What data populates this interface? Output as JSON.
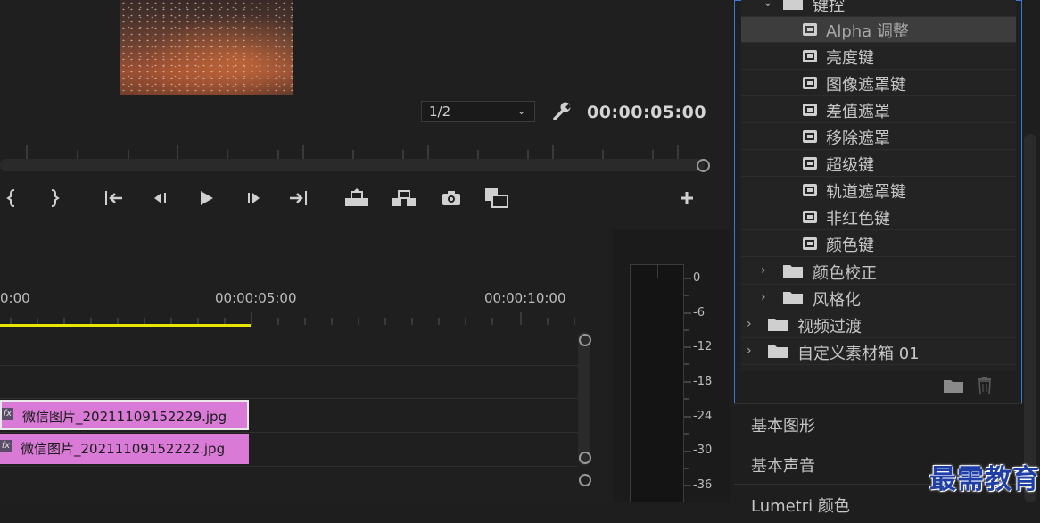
{
  "monitor": {
    "zoom": "1/2",
    "timecode": "00:00:05:00"
  },
  "timeline": {
    "timecodes": [
      "0:00",
      "00:00:05:00",
      "00:00:10:00"
    ],
    "clips": [
      {
        "fx": "fx",
        "name": "微信图片_20211109152229.jpg"
      },
      {
        "fx": "fx",
        "name": "微信图片_20211109152222.jpg"
      }
    ]
  },
  "meters": {
    "scale": [
      "0",
      "-6",
      "-12",
      "-18",
      "-24",
      "-30",
      "-36"
    ]
  },
  "effects": {
    "folder_top": "键控",
    "presets": [
      "Alpha 调整",
      "亮度键",
      "图像遮罩键",
      "差值遮罩",
      "移除遮罩",
      "超级键",
      "轨道遮罩键",
      "非红色键",
      "颜色键"
    ],
    "subfolders": [
      "颜色校正",
      "风格化"
    ],
    "root_folders": [
      "视频过渡",
      "自定义素材箱 01"
    ]
  },
  "panels": [
    "基本图形",
    "基本声音",
    "Lumetri 颜色"
  ],
  "watermark": "最需教育",
  "colors": {
    "accent": "#3a7ad6",
    "clip": "#d97ad6",
    "work_area": "#e6e600"
  }
}
